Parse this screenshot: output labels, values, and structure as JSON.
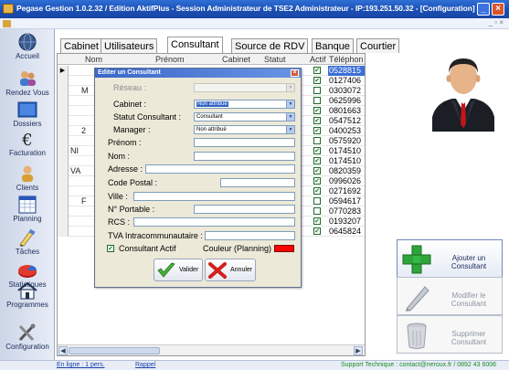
{
  "window": {
    "title": "Pegase Gestion 1.0.2.32 / Edition AktifPlus - Session Administrateur de TSE2 Administrateur - IP:193.251.50.32 - [Configuration]",
    "minimize_glyph": "_",
    "close_glyph": "×"
  },
  "menubar": {
    "controls": "_ ▫ ×"
  },
  "sidebar": {
    "items": [
      {
        "label": "Accueil",
        "icon": "globe-icon"
      },
      {
        "label": "Rendez Vous",
        "icon": "people-icon"
      },
      {
        "label": "Dossiers",
        "icon": "folder-icon"
      },
      {
        "label": "Facturation",
        "icon": "euro-icon"
      },
      {
        "label": "Clients",
        "icon": "client-icon"
      },
      {
        "label": "Planning",
        "icon": "calendar-icon"
      },
      {
        "label": "Tâches",
        "icon": "tasks-icon"
      },
      {
        "label": "Statistiques",
        "icon": "stats-icon"
      },
      {
        "label": "Programmes",
        "icon": "home-icon"
      },
      {
        "label": "Configuration",
        "icon": "tools-icon"
      }
    ]
  },
  "tabs": [
    {
      "label": "Cabinet"
    },
    {
      "label": "Utilisateurs"
    },
    {
      "label": "Consultant",
      "active": true
    },
    {
      "label": "Source de RDV"
    },
    {
      "label": "Banque"
    },
    {
      "label": "Courtier"
    }
  ],
  "grid": {
    "columns": [
      "Nom",
      "Prénom",
      "Cabinet",
      "Statut",
      "Actif",
      "Téléphon"
    ],
    "rows": [
      {
        "frag": "",
        "actif": true,
        "phone": "0528815",
        "selected": true
      },
      {
        "frag": "",
        "actif": true,
        "phone": "0127406"
      },
      {
        "frag": "M",
        "actif": false,
        "phone": "0303072"
      },
      {
        "frag": "",
        "actif": false,
        "phone": "0625996"
      },
      {
        "frag": "",
        "actif": true,
        "phone": "0801663"
      },
      {
        "frag": "",
        "actif": true,
        "phone": "0547512"
      },
      {
        "frag": "2",
        "actif": true,
        "phone": "0400253"
      },
      {
        "frag": "",
        "actif": false,
        "phone": "0575920"
      },
      {
        "frag": "NI",
        "actif": true,
        "phone": "0174510"
      },
      {
        "frag": "",
        "actif": true,
        "phone": "0174510"
      },
      {
        "frag": "VA",
        "actif": true,
        "phone": "0820359"
      },
      {
        "frag": "",
        "actif": true,
        "phone": "0996026"
      },
      {
        "frag": "",
        "actif": true,
        "phone": "0271692"
      },
      {
        "frag": "F",
        "actif": false,
        "phone": "0594617"
      },
      {
        "frag": "",
        "actif": false,
        "phone": "0770283"
      },
      {
        "frag": "",
        "actif": true,
        "phone": "0193207"
      },
      {
        "frag": "",
        "actif": true,
        "phone": "0645824"
      }
    ]
  },
  "dialog": {
    "title": "Editer un Consultant",
    "close_glyph": "×",
    "fields": {
      "reseau": {
        "label": "Réseau :",
        "value": ""
      },
      "cabinet": {
        "label": "Cabinet :",
        "value": "Non attribué"
      },
      "statut": {
        "label": "Statut Consultant :",
        "value": "Consultant"
      },
      "manager": {
        "label": "Manager :",
        "value": "Non attribué"
      },
      "prenom": {
        "label": "Prénom :",
        "value": ""
      },
      "nom": {
        "label": "Nom :",
        "value": ""
      },
      "adresse": {
        "label": "Adresse :",
        "value": ""
      },
      "code_postal": {
        "label": "Code Postal :",
        "value": ""
      },
      "ville": {
        "label": "Ville :",
        "value": ""
      },
      "portable": {
        "label": "N° Portable :",
        "value": ""
      },
      "rcs": {
        "label": "RCS :",
        "value": ""
      },
      "tva": {
        "label": "TVA Intracommunautaire :",
        "value": ""
      }
    },
    "actif_label": "Consultant Actif",
    "actif_checked": true,
    "couleur_label": "Couleur (Planning) :",
    "couleur_value": "#ff0000",
    "valider": "Valider",
    "annuler": "Annuler"
  },
  "actions": {
    "add": "Ajouter un Consultant",
    "modify": "Modifier le Consultant",
    "delete": "Supprimer Consultant"
  },
  "statusbar": {
    "online": "En ligne : 1 pers.",
    "rappel": "Rappel",
    "support": "Support Technique : contact@neroux.fr / 0892 43 6006"
  },
  "colors": {
    "titlebar": "#1b4fb4",
    "selection": "#3b6fd6",
    "accent_green": "#1b8a2b"
  }
}
